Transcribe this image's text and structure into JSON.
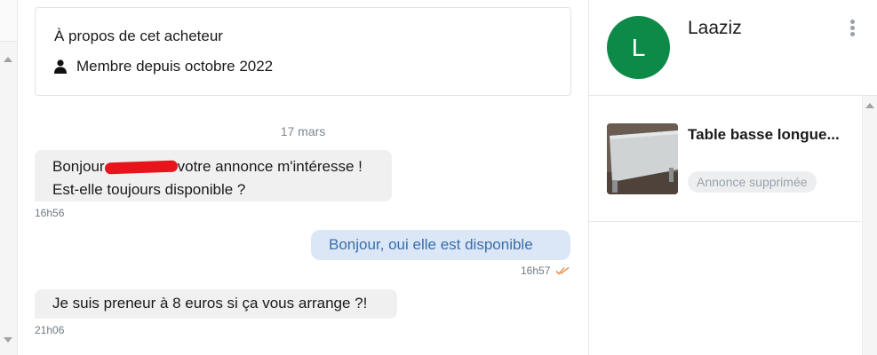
{
  "about": {
    "title": "À propos de cet acheteur",
    "member_since": "Membre depuis octobre 2022"
  },
  "conversation": {
    "date_separator": "17 mars",
    "messages": [
      {
        "direction": "in",
        "line1_before": "Bonjour",
        "line1_after": "votre annonce m'intéresse !",
        "line2": "Est-elle toujours disponible ?",
        "time": "16h56"
      },
      {
        "direction": "out",
        "text": "Bonjour, oui elle est disponible",
        "time": "16h57",
        "read_icon": "double-check-icon"
      },
      {
        "direction": "in",
        "text": "Je suis preneur à 8 euros si ça vous arrange ?!",
        "time": "21h06"
      }
    ]
  },
  "contact": {
    "avatar_letter": "L",
    "avatar_color": "#0e8a48",
    "name": "Laaziz",
    "menu_icon": "kebab-menu-icon"
  },
  "listing": {
    "title": "Table basse longue...",
    "status": "Annonce supprimée"
  },
  "colors": {
    "outgoing_bubble": "#dbe7f7",
    "outgoing_text": "#3a6ea8",
    "incoming_bubble": "#f0f0f1",
    "read_check": "#e8823a"
  }
}
